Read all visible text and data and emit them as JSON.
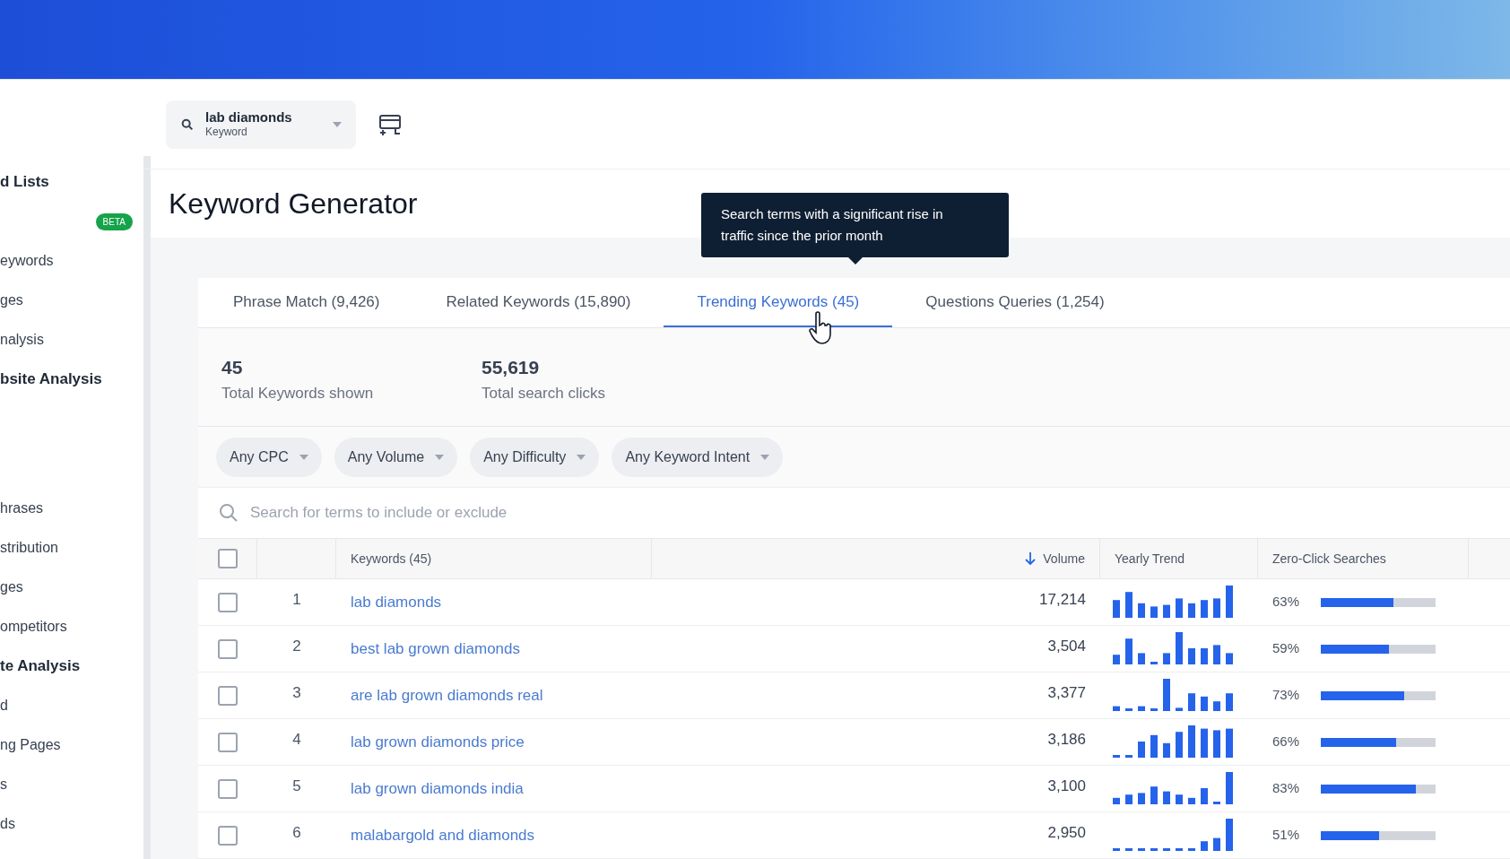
{
  "sidebar": {
    "items": [
      {
        "label": "d Lists",
        "kind": "heading"
      },
      {
        "label": "BETA",
        "kind": "badge"
      },
      {
        "label": "eywords",
        "kind": "item"
      },
      {
        "label": "ges",
        "kind": "item"
      },
      {
        "label": "nalysis",
        "kind": "item"
      },
      {
        "label": "bsite Analysis",
        "kind": "heading"
      },
      {
        "kind": "spacer"
      },
      {
        "label": "hrases",
        "kind": "item"
      },
      {
        "label": "stribution",
        "kind": "item"
      },
      {
        "label": "ges",
        "kind": "item"
      },
      {
        "label": "ompetitors",
        "kind": "item"
      },
      {
        "label": "te Analysis",
        "kind": "heading"
      },
      {
        "label": "d",
        "kind": "item"
      },
      {
        "label": "ng Pages",
        "kind": "item"
      },
      {
        "label": "s",
        "kind": "item"
      },
      {
        "label": "ds",
        "kind": "item"
      }
    ]
  },
  "search": {
    "value": "lab diamonds",
    "type": "Keyword"
  },
  "title": "Keyword Generator",
  "tooltip": "Search terms with a significant rise in traffic since the prior month",
  "tabs": [
    {
      "label": "Phrase Match (9,426)",
      "selected": false
    },
    {
      "label": "Related Keywords (15,890)",
      "selected": false
    },
    {
      "label": "Trending Keywords (45)",
      "selected": true
    },
    {
      "label": "Questions Queries (1,254)",
      "selected": false
    }
  ],
  "stats": [
    {
      "value": "45",
      "label": "Total Keywords shown"
    },
    {
      "value": "55,619",
      "label": "Total search clicks"
    }
  ],
  "filters": [
    "Any CPC",
    "Any Volume",
    "Any Difficulty",
    "Any Keyword Intent"
  ],
  "filter_search": {
    "placeholder": "Search for terms to include or exclude"
  },
  "table": {
    "columns": {
      "keywords": "Keywords (45)",
      "volume": "Volume",
      "trend": "Yearly Trend",
      "zero_click": "Zero-Click Searches"
    },
    "select_all_checked": false,
    "rows": [
      {
        "rank": "1",
        "keyword": "lab diamonds",
        "volume": "17,214",
        "zero_click": "63%",
        "level": 0.63,
        "checked": false
      },
      {
        "rank": "2",
        "keyword": "best lab grown diamonds",
        "volume": "3,504",
        "zero_click": "59%",
        "level": 0.59,
        "checked": false
      },
      {
        "rank": "3",
        "keyword": "are lab grown diamonds real",
        "volume": "3,377",
        "zero_click": "73%",
        "level": 0.73,
        "checked": false
      },
      {
        "rank": "4",
        "keyword": "lab grown diamonds price",
        "volume": "3,186",
        "zero_click": "66%",
        "level": 0.66,
        "checked": false
      },
      {
        "rank": "5",
        "keyword": "lab grown diamonds india",
        "volume": "3,100",
        "zero_click": "83%",
        "level": 0.83,
        "checked": false
      },
      {
        "rank": "6",
        "keyword": "malabargold and diamonds",
        "volume": "2,950",
        "zero_click": "51%",
        "level": 0.51,
        "checked": false
      }
    ]
  }
}
